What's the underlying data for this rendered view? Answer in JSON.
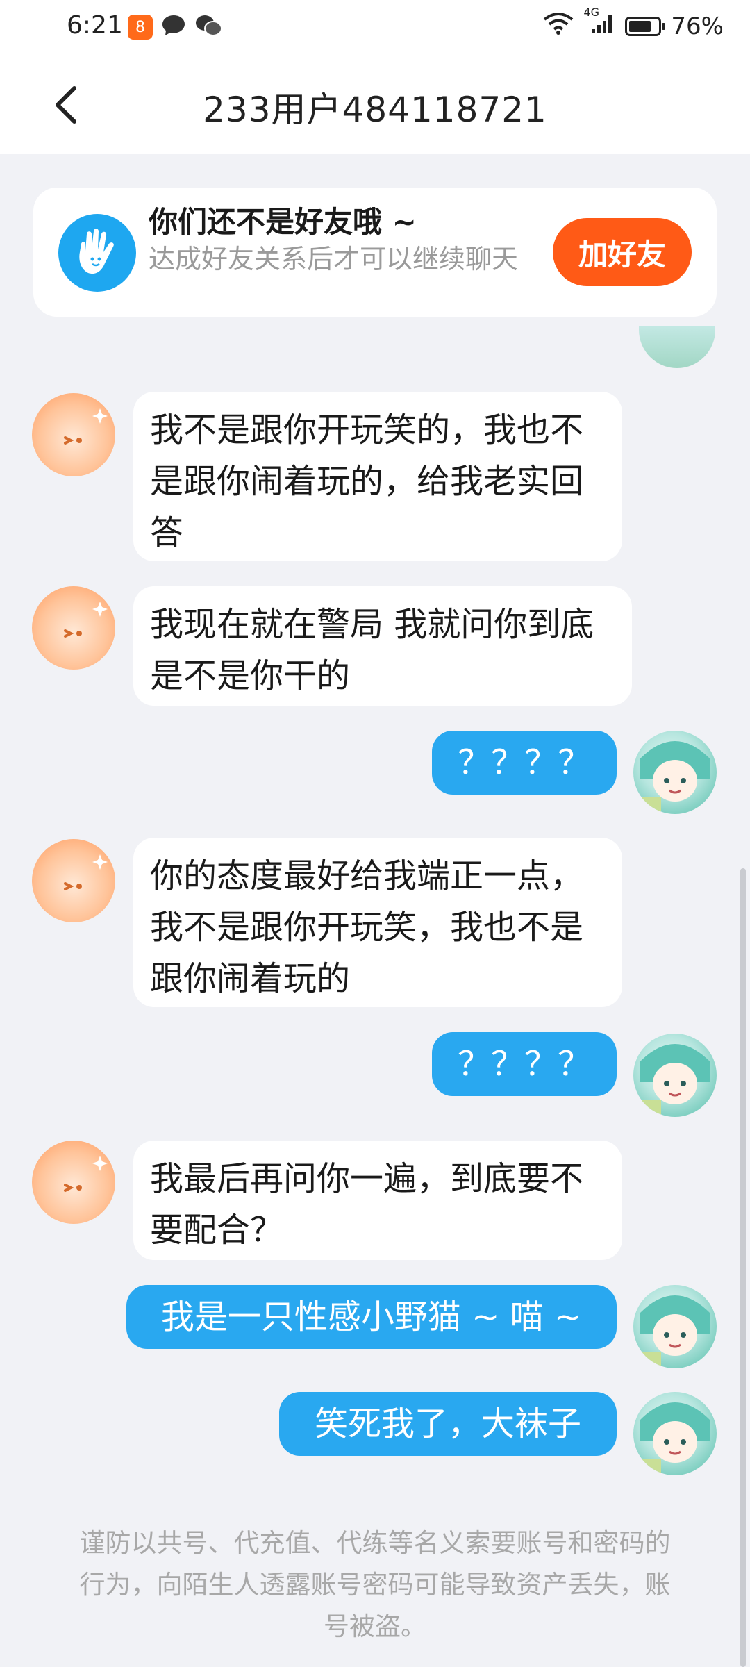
{
  "status_bar": {
    "time": "6:21",
    "app_badge": "8",
    "network": "4G",
    "battery_percent": "76%",
    "battery_level": 0.76,
    "icons": [
      "app-badge-icon",
      "message-bubble-icon",
      "wechat-icon",
      "wifi-icon",
      "signal-icon",
      "battery-icon"
    ]
  },
  "header": {
    "title": "233用户484118721",
    "back_icon": "back-chevron-icon"
  },
  "friend_notice": {
    "title": "你们还不是好友哦 ~",
    "subtitle": "达成好友关系后才可以继续聊天",
    "button_label": "加好友",
    "icon": "wave-hand-icon",
    "accent_color": "#ff5a16",
    "icon_color": "#1ea7f0"
  },
  "messages": [
    {
      "side": "left",
      "text": "我不是跟你开玩笑的，我也不是跟你闹着玩的，给我老实回答"
    },
    {
      "side": "left",
      "text": "我现在就在警局 我就问你到底是不是你干的"
    },
    {
      "side": "right",
      "text": "？？？？"
    },
    {
      "side": "left",
      "text": "你的态度最好给我端正一点，我不是跟你开玩笑，我也不是跟你闹着玩的"
    },
    {
      "side": "right",
      "text": "？？？？"
    },
    {
      "side": "left",
      "text": "我最后再问你一遍，到底要不要配合？"
    },
    {
      "side": "right",
      "text": "我是一只性感小野猫 ~ 喵 ~"
    },
    {
      "side": "right",
      "text": "笑死我了，大袜子"
    }
  ],
  "warning": "谨防以共号、代充值、代练等名义索要账号和密码的行为，向陌生人透露账号密码可能导致资产丢失，账号被盗。",
  "colors": {
    "self_bubble": "#29a8f0",
    "other_bubble": "#ffffff",
    "background": "#f1f2f6"
  }
}
